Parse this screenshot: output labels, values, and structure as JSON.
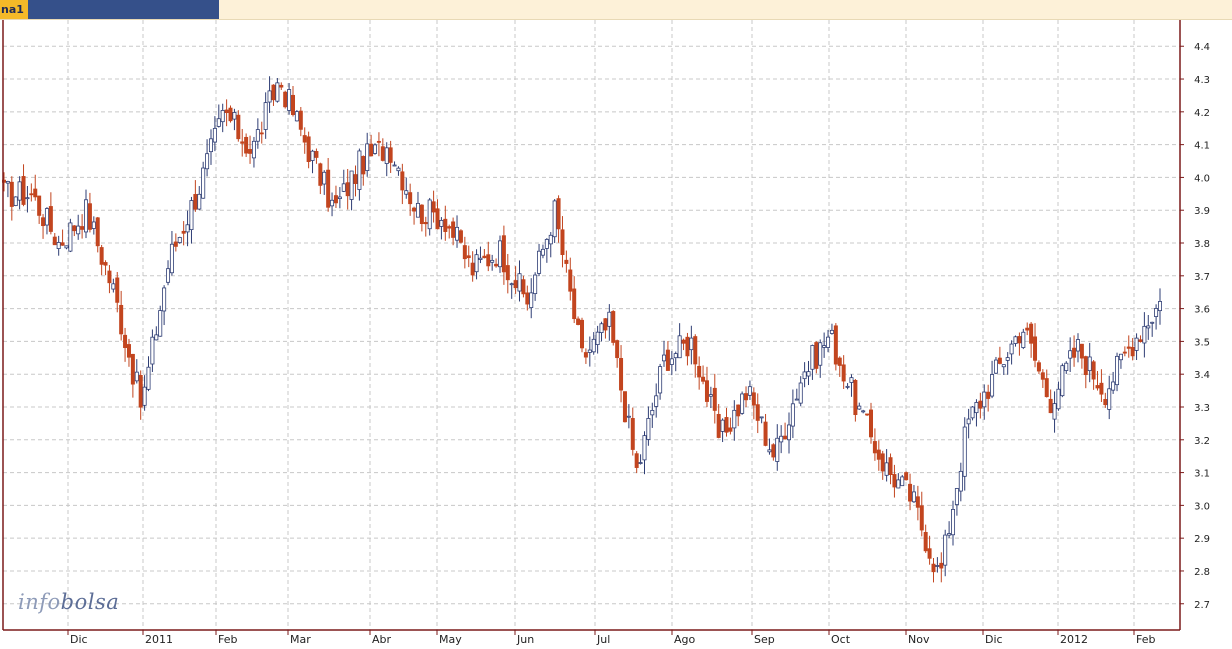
{
  "tab": {
    "label": "na1"
  },
  "watermark": {
    "prefix": "info",
    "suffix": "bolsa"
  },
  "colors": {
    "up": "#2e3d74",
    "down": "#c2451f",
    "grid": "#c8c8c8",
    "axis": "#7b1a1a",
    "tab_accent": "#f4b928",
    "tab_dark": "#35508a",
    "topbar": "#fdf1d8"
  },
  "chart_data": {
    "type": "candlestick",
    "title": "",
    "xlabel": "",
    "ylabel": "",
    "ylim": [
      2.62,
      4.48
    ],
    "y_ticks": [
      2.7,
      2.8,
      2.9,
      3.0,
      3.1,
      3.2,
      3.3,
      3.4,
      3.5,
      3.6,
      3.7,
      3.8,
      3.9,
      4.0,
      4.1,
      4.2,
      4.3,
      4.4
    ],
    "x_ticks": [
      "Dic",
      "2011",
      "Feb",
      "Mar",
      "Abr",
      "May",
      "Jun",
      "Jul",
      "Ago",
      "Sep",
      "Oct",
      "Nov",
      "Dic",
      "2012",
      "Feb"
    ],
    "grid": true,
    "points": [
      {
        "period": "Nov 2010 (late)",
        "close": 3.95
      },
      {
        "period": "Dic 2010",
        "close": 3.8
      },
      {
        "period": "Dic 2010 (mid)",
        "close": 3.9
      },
      {
        "period": "Dic 2010 (late)",
        "close": 3.65
      },
      {
        "period": "Dic 2010 (end)",
        "close": 3.3
      },
      {
        "period": "2011 (early Jan)",
        "close": 3.75
      },
      {
        "period": "Jan 2011",
        "close": 3.95
      },
      {
        "period": "Jan 2011 (late)",
        "close": 4.2
      },
      {
        "period": "Feb 2011",
        "close": 4.08
      },
      {
        "period": "Feb 2011 (mid)",
        "close": 4.3
      },
      {
        "period": "Feb 2011 (late)",
        "close": 4.1
      },
      {
        "period": "Mar 2011",
        "close": 3.9
      },
      {
        "period": "Mar 2011 (mid)",
        "close": 4.05
      },
      {
        "period": "Abr 2011",
        "close": 4.1
      },
      {
        "period": "Abr 2011 (mid)",
        "close": 3.9
      },
      {
        "period": "May 2011",
        "close": 3.88
      },
      {
        "period": "May 2011 (late)",
        "close": 3.72
      },
      {
        "period": "Jun 2011",
        "close": 3.78
      },
      {
        "period": "Jun 2011 (late)",
        "close": 3.62
      },
      {
        "period": "Jul 2011",
        "close": 3.9
      },
      {
        "period": "Jul 2011 (mid)",
        "close": 3.45
      },
      {
        "period": "Jul 2011 (late)",
        "close": 3.55
      },
      {
        "period": "Ago 2011",
        "close": 3.1
      },
      {
        "period": "Ago 2011 (mid)",
        "close": 3.45
      },
      {
        "period": "Ago 2011 (late)",
        "close": 3.5
      },
      {
        "period": "Sep 2011",
        "close": 3.2
      },
      {
        "period": "Sep 2011 (mid)",
        "close": 3.35
      },
      {
        "period": "Sep 2011 (late)",
        "close": 3.15
      },
      {
        "period": "Oct 2011",
        "close": 3.4
      },
      {
        "period": "Oct 2011 (mid)",
        "close": 3.52
      },
      {
        "period": "Oct 2011 (late)",
        "close": 3.3
      },
      {
        "period": "Nov 2011",
        "close": 3.12
      },
      {
        "period": "Nov 2011 (mid)",
        "close": 3.02
      },
      {
        "period": "Nov 2011 (late)",
        "close": 2.78
      },
      {
        "period": "Dic 2011",
        "close": 3.25
      },
      {
        "period": "Dic 2011 (mid)",
        "close": 3.4
      },
      {
        "period": "Dic 2011 (late)",
        "close": 3.55
      },
      {
        "period": "2012 (early Jan)",
        "close": 3.32
      },
      {
        "period": "Jan 2012",
        "close": 3.48
      },
      {
        "period": "Jan 2012 (late)",
        "close": 3.35
      },
      {
        "period": "Feb 2012",
        "close": 3.5
      },
      {
        "period": "Feb 2012 (mid)",
        "close": 3.62
      }
    ]
  }
}
